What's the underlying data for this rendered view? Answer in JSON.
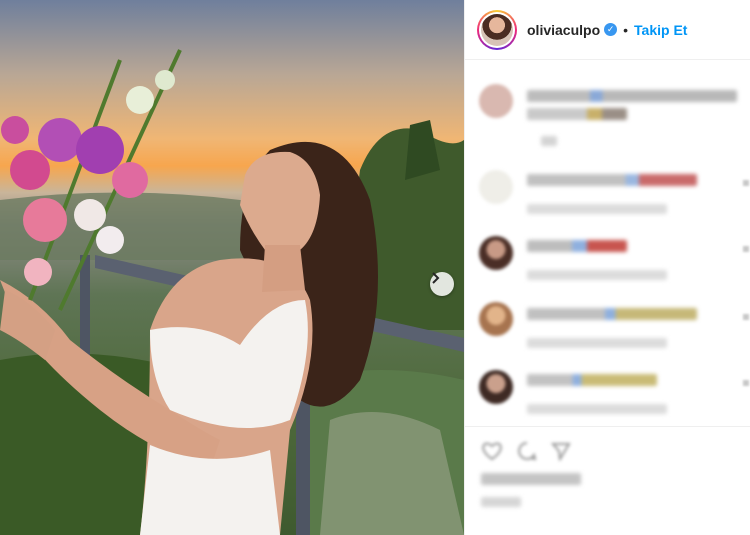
{
  "post": {
    "username": "oliviaculpo",
    "separator": "•",
    "follow_label": "Takip Et"
  },
  "icons": {
    "verified": "verified-badge-icon",
    "next": "chevron-right-icon",
    "like": "heart-icon",
    "comment": "comment-icon",
    "share": "send-icon"
  },
  "colors": {
    "follow_blue": "#0095f6",
    "verified_blue": "#3897f0",
    "border": "#efefef"
  }
}
